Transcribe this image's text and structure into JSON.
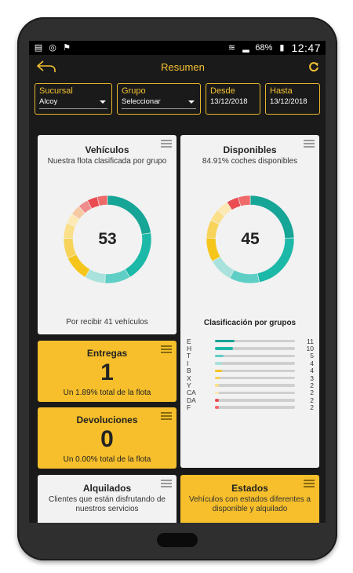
{
  "statusbar": {
    "battery": "68%",
    "time": "12:47"
  },
  "appbar": {
    "title": "Resumen"
  },
  "filters": [
    {
      "label": "Sucursal",
      "value": "Alcoy"
    },
    {
      "label": "Grupo",
      "value": "Seleccionar"
    },
    {
      "label": "Desde",
      "value": "13/12/2018"
    },
    {
      "label": "Hasta",
      "value": "13/12/2018"
    }
  ],
  "vehiculos": {
    "title": "Vehículos",
    "subtitle": "Nuestra flota clasificada por grupo",
    "total": "53",
    "footer": "Por recibir 41 vehículos"
  },
  "disponibles": {
    "title": "Disponibles",
    "subtitle": "84.91% coches disponibles",
    "total": "45",
    "class_title": "Clasificación por grupos"
  },
  "entregas": {
    "title": "Entregas",
    "value": "1",
    "footer": "Un 1.89% total de la flota"
  },
  "devoluciones": {
    "title": "Devoluciones",
    "value": "0",
    "footer": "Un 0.00% total de la flota"
  },
  "alquilados": {
    "title": "Alquilados",
    "subtitle": "Clientes que están disfrutando de nuestros servicios"
  },
  "estados": {
    "title": "Estados",
    "subtitle": "Vehículos con estados diferentes a disponible y alquilado"
  },
  "chart_data": [
    {
      "type": "pie",
      "values": [
        12,
        10,
        5,
        4,
        5,
        4,
        3,
        2,
        2,
        2,
        2,
        2
      ],
      "colors": [
        "#16a596",
        "#1cb8a8",
        "#5fcfc6",
        "#a9e2dc",
        "#f5c51a",
        "#f8d35a",
        "#fbe08a",
        "#fde9b4",
        "#f7c9a2",
        "#f08c8c",
        "#ea4c52",
        "#f06a6a"
      ]
    },
    {
      "type": "pie",
      "values": [
        11,
        10,
        5,
        4,
        4,
        3,
        2,
        2,
        2,
        2
      ],
      "colors": [
        "#16a596",
        "#1cb8a8",
        "#5fcfc6",
        "#a9e2dc",
        "#f5c51a",
        "#f8d35a",
        "#fbe08a",
        "#fde9b4",
        "#ea4c52",
        "#f06a6a"
      ]
    },
    {
      "type": "bar",
      "categories": [
        "E",
        "H",
        "T",
        "I",
        "B",
        "X",
        "Y",
        "CA",
        "DA",
        "F"
      ],
      "values": [
        11,
        10,
        5,
        4,
        4,
        3,
        2,
        2,
        2,
        2
      ],
      "max": 45,
      "colors": [
        "#16a596",
        "#1cb8a8",
        "#5fcfc6",
        "#a9e2dc",
        "#f5c51a",
        "#f8d35a",
        "#fbe08a",
        "#fde9b4",
        "#ea4c52",
        "#f06a6a"
      ]
    }
  ]
}
